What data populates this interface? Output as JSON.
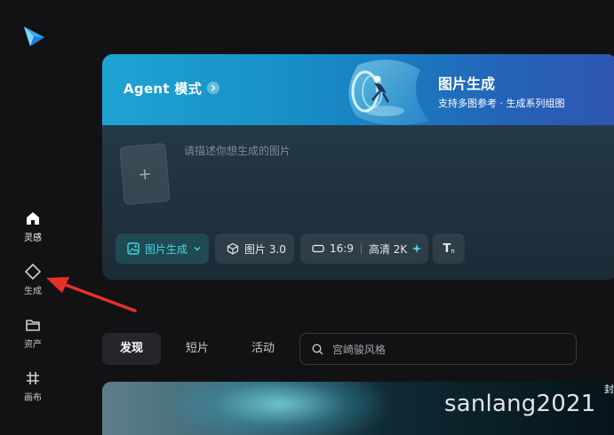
{
  "sidebar": {
    "items": [
      {
        "label": "灵感",
        "icon": "home-icon"
      },
      {
        "label": "生成",
        "icon": "diamond-icon"
      },
      {
        "label": "资产",
        "icon": "folder-icon"
      },
      {
        "label": "画布",
        "icon": "grid-hash-icon"
      }
    ]
  },
  "banner": {
    "left_title": "Agent 模式",
    "right_title": "图片生成",
    "right_subtitle": "支持多图参考 · 生成系列组图"
  },
  "composer": {
    "prompt_placeholder": "请描述你想生成的图片",
    "upload_symbol": "+"
  },
  "toolbar": {
    "mode_label": "图片生成",
    "model_label": "图片 3.0",
    "ratio_label": "16:9",
    "quality_label": "高清 2K",
    "text_tool_label": "T"
  },
  "explore": {
    "tabs": [
      "发现",
      "短片",
      "活动"
    ],
    "search_placeholder": "宫崎骏风格"
  },
  "overlay": {
    "watermark": "sanlang2021",
    "edge_text": "封"
  },
  "colors": {
    "accent": "#45d4e0",
    "annotation_arrow": "#e8302a"
  }
}
